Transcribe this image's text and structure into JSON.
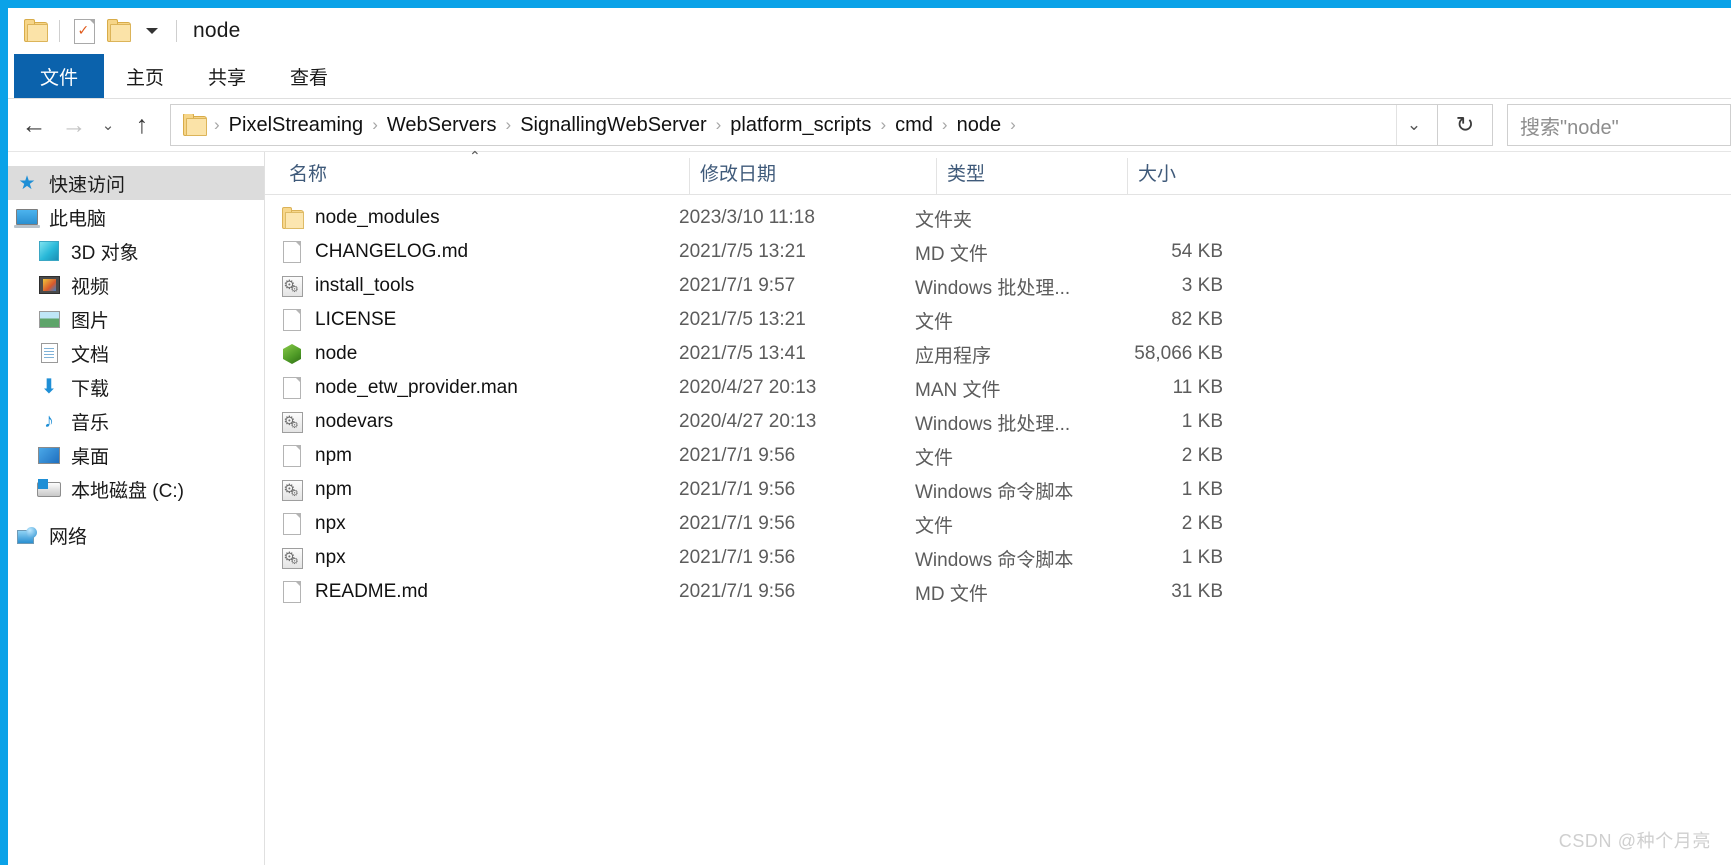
{
  "window": {
    "title": "node",
    "accent_color": "#0aa2e8",
    "quick_access": [
      {
        "name": "folder-icon",
        "label": "folder"
      },
      {
        "name": "properties-checkmark-icon",
        "label": "properties"
      },
      {
        "name": "new-folder-icon",
        "label": "new folder"
      },
      {
        "name": "customize-dropdown-icon",
        "label": "customize quick access toolbar"
      }
    ]
  },
  "ribbon": {
    "tabs": [
      {
        "label": "文件",
        "selected": true
      },
      {
        "label": "主页",
        "selected": false
      },
      {
        "label": "共享",
        "selected": false
      },
      {
        "label": "查看",
        "selected": false
      }
    ]
  },
  "address_bar": {
    "back_label": "←",
    "forward_label": "→",
    "recent_label": "⌄",
    "up_label": "↑",
    "breadcrumbs": [
      "PixelStreaming",
      "WebServers",
      "SignallingWebServer",
      "platform_scripts",
      "cmd",
      "node"
    ],
    "separator": "›",
    "dropdown_label": "⌄",
    "refresh_label": "↻",
    "search_placeholder": "搜索\"node\""
  },
  "sidebar": {
    "items": [
      {
        "label": "快速访问",
        "icon": "star-pin-icon",
        "level": 0,
        "selected": true
      },
      {
        "label": "此电脑",
        "icon": "this-pc-icon",
        "level": 0,
        "selected": false
      },
      {
        "label": "3D 对象",
        "icon": "3d-objects-icon",
        "level": 1,
        "selected": false
      },
      {
        "label": "视频",
        "icon": "videos-icon",
        "level": 1,
        "selected": false
      },
      {
        "label": "图片",
        "icon": "pictures-icon",
        "level": 1,
        "selected": false
      },
      {
        "label": "文档",
        "icon": "documents-icon",
        "level": 1,
        "selected": false
      },
      {
        "label": "下载",
        "icon": "downloads-icon",
        "level": 1,
        "selected": false
      },
      {
        "label": "音乐",
        "icon": "music-icon",
        "level": 1,
        "selected": false
      },
      {
        "label": "桌面",
        "icon": "desktop-icon",
        "level": 1,
        "selected": false
      },
      {
        "label": "本地磁盘 (C:)",
        "icon": "local-disk-icon",
        "level": 1,
        "selected": false
      },
      {
        "label": "网络",
        "icon": "network-icon",
        "level": 0,
        "selected": false
      }
    ]
  },
  "file_list": {
    "columns": [
      {
        "label": "名称",
        "key": "name",
        "sorted": true,
        "sort_direction": "asc",
        "sort_glyph": "⌃"
      },
      {
        "label": "修改日期",
        "key": "date"
      },
      {
        "label": "类型",
        "key": "type"
      },
      {
        "label": "大小",
        "key": "size"
      }
    ],
    "rows": [
      {
        "name": "node_modules",
        "date": "2023/3/10 11:18",
        "type": "文件夹",
        "size": "",
        "icon": "folder-icon"
      },
      {
        "name": "CHANGELOG.md",
        "date": "2021/7/5 13:21",
        "type": "MD 文件",
        "size": "54 KB",
        "icon": "generic-file-icon"
      },
      {
        "name": "install_tools",
        "date": "2021/7/1 9:57",
        "type": "Windows 批处理...",
        "size": "3 KB",
        "icon": "batch-file-icon"
      },
      {
        "name": "LICENSE",
        "date": "2021/7/5 13:21",
        "type": "文件",
        "size": "82 KB",
        "icon": "generic-file-icon"
      },
      {
        "name": "node",
        "date": "2021/7/5 13:41",
        "type": "应用程序",
        "size": "58,066 KB",
        "icon": "nodejs-app-icon"
      },
      {
        "name": "node_etw_provider.man",
        "date": "2020/4/27 20:13",
        "type": "MAN 文件",
        "size": "11 KB",
        "icon": "generic-file-icon"
      },
      {
        "name": "nodevars",
        "date": "2020/4/27 20:13",
        "type": "Windows 批处理...",
        "size": "1 KB",
        "icon": "batch-file-icon"
      },
      {
        "name": "npm",
        "date": "2021/7/1 9:56",
        "type": "文件",
        "size": "2 KB",
        "icon": "generic-file-icon"
      },
      {
        "name": "npm",
        "date": "2021/7/1 9:56",
        "type": "Windows 命令脚本",
        "size": "1 KB",
        "icon": "batch-file-icon"
      },
      {
        "name": "npx",
        "date": "2021/7/1 9:56",
        "type": "文件",
        "size": "2 KB",
        "icon": "generic-file-icon"
      },
      {
        "name": "npx",
        "date": "2021/7/1 9:56",
        "type": "Windows 命令脚本",
        "size": "1 KB",
        "icon": "batch-file-icon"
      },
      {
        "name": "README.md",
        "date": "2021/7/1 9:56",
        "type": "MD 文件",
        "size": "31 KB",
        "icon": "generic-file-icon"
      }
    ]
  },
  "watermark": {
    "text": "CSDN @种个月亮"
  }
}
